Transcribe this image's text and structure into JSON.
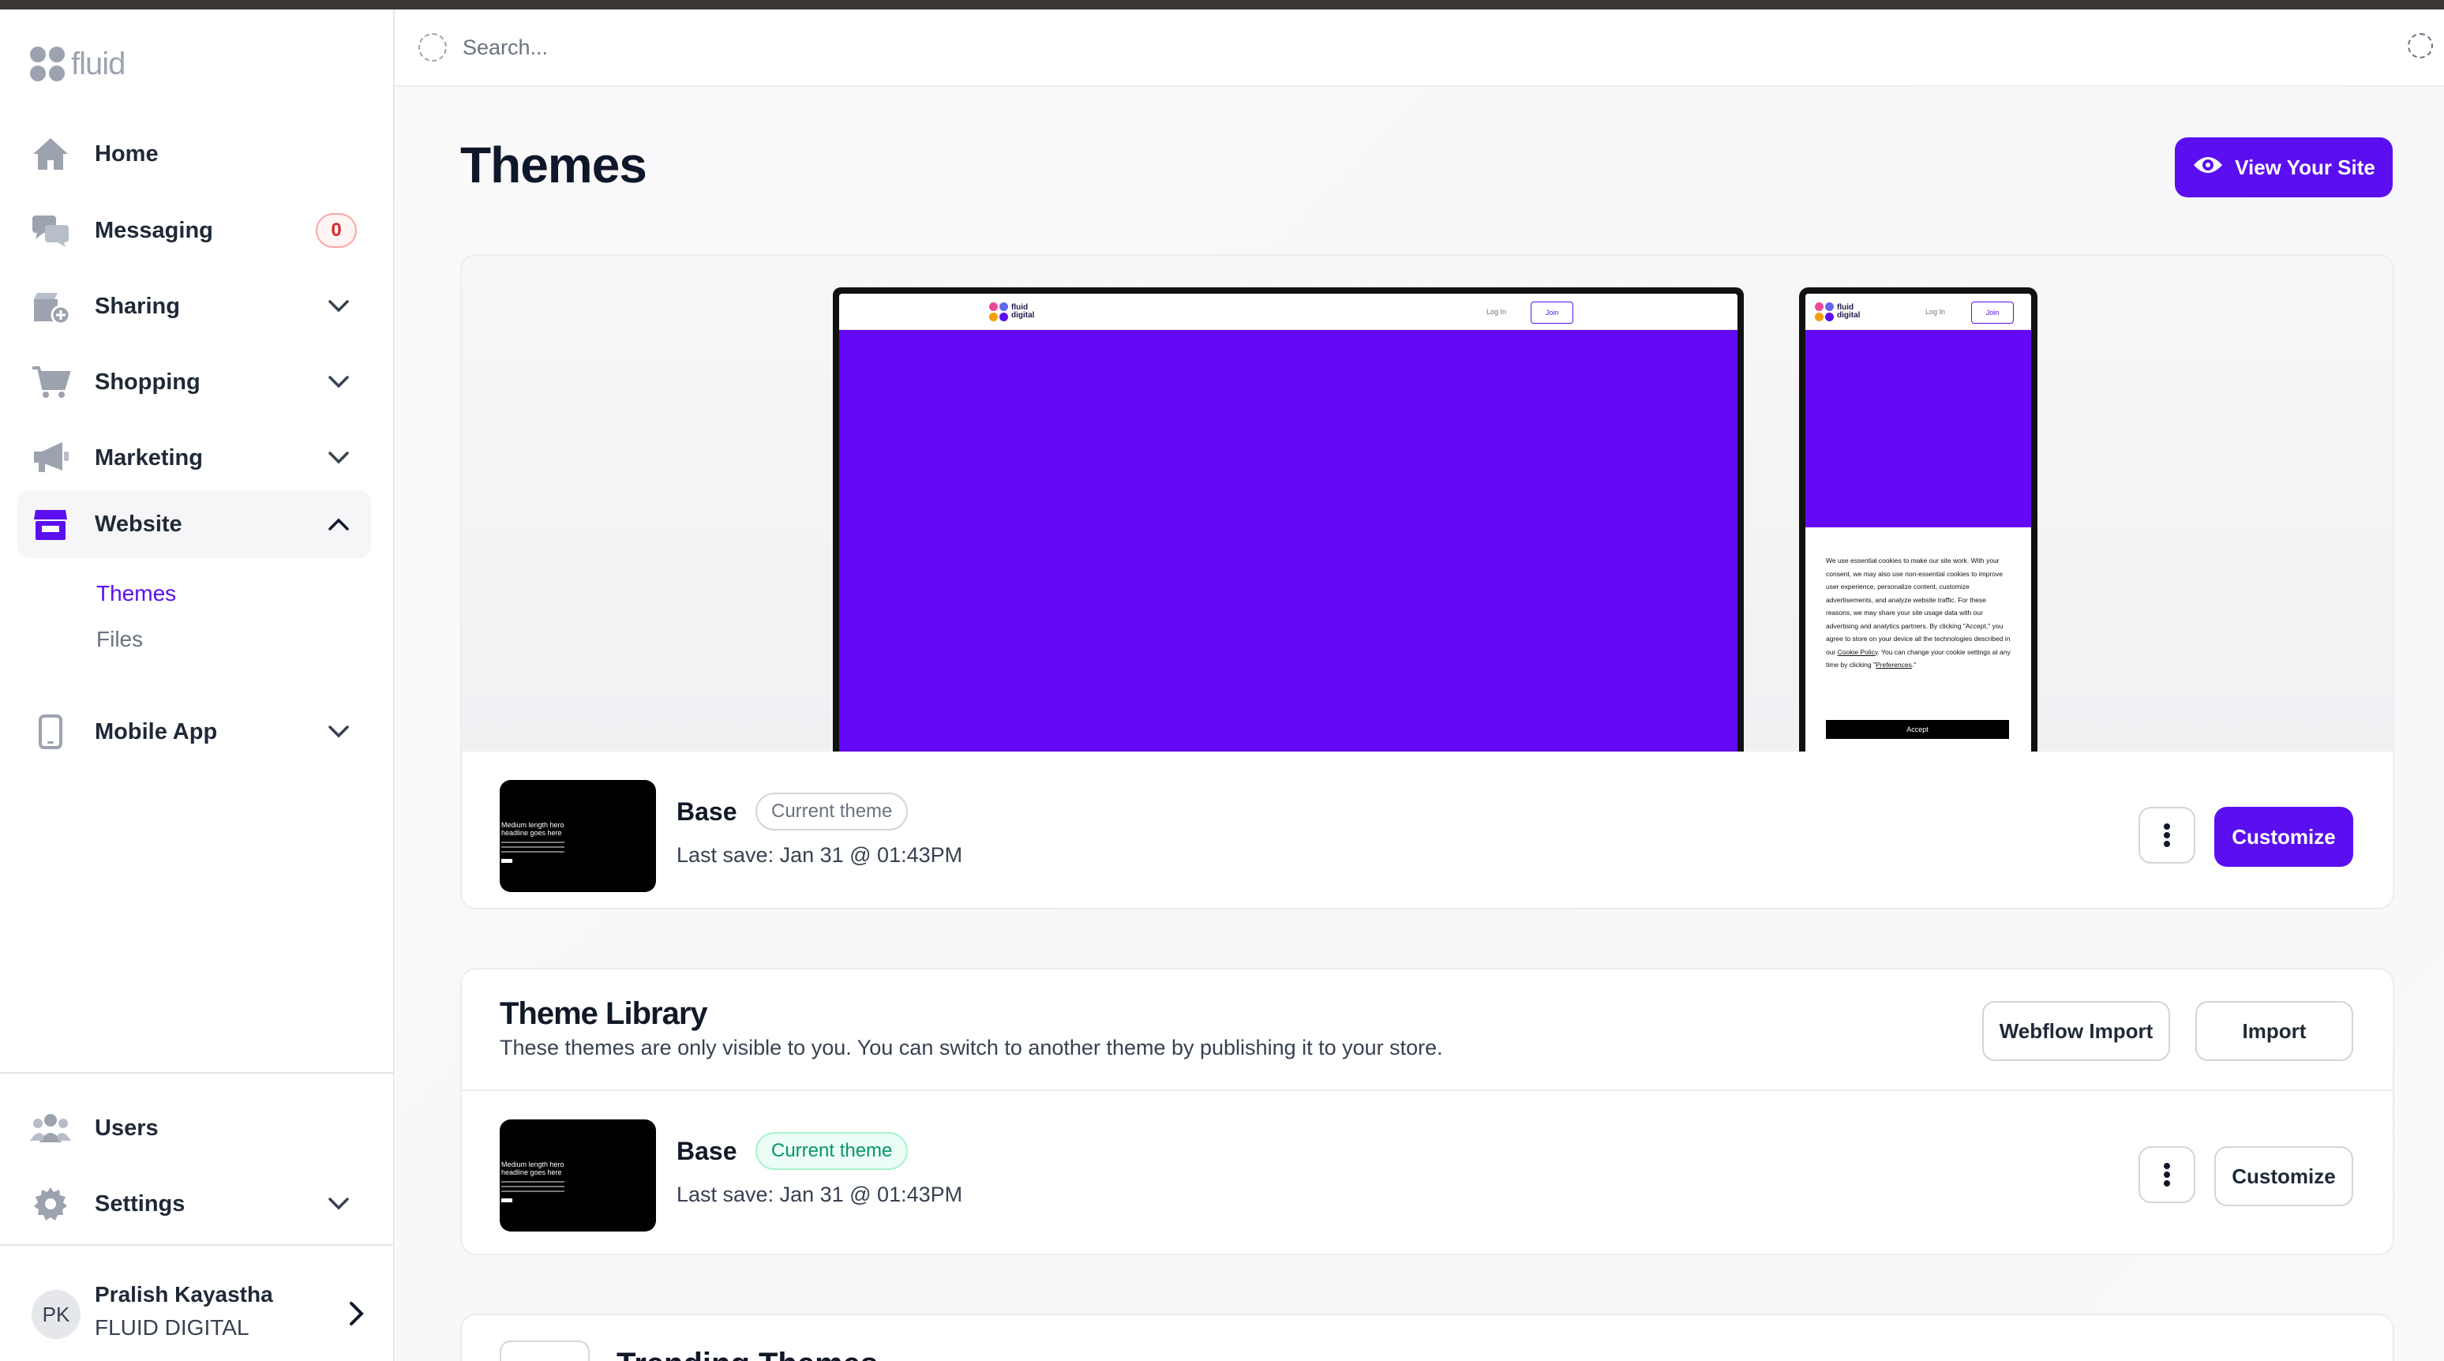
{
  "app": {
    "logo_text": "fluid"
  },
  "search": {
    "placeholder": "Search..."
  },
  "sidebar": {
    "items": [
      {
        "label": "Home"
      },
      {
        "label": "Messaging",
        "badge": "0"
      },
      {
        "label": "Sharing"
      },
      {
        "label": "Shopping"
      },
      {
        "label": "Marketing"
      },
      {
        "label": "Website",
        "sub_items": [
          "Themes",
          "Files"
        ]
      },
      {
        "label": "Mobile App"
      }
    ],
    "bottom_items": [
      {
        "label": "Users"
      },
      {
        "label": "Settings"
      }
    ],
    "user": {
      "initials": "PK",
      "name": "Pralish Kayastha",
      "org": "FLUID DIGITAL"
    }
  },
  "page": {
    "title": "Themes",
    "view_site_label": "View Your Site"
  },
  "preview": {
    "site_logo": "fluid digital",
    "login_label": "Log In",
    "join_label": "Join",
    "cookie_text_pre": "We use essential cookies to make our site work. With your consent, we may also use non-essential cookies to improve user experience, personalize content, customize advertisements, and analyze website traffic. For these reasons, we may share your site usage data with our advertising and analytics partners. By clicking \"Accept,\" you agree to store on your device all the technologies described in our ",
    "cookie_link": "Cookie Policy",
    "cookie_text_mid": ". You can change your cookie settings at any time by clicking \"",
    "cookie_link2": "Preferences",
    "cookie_text_end": ".\"",
    "accept_label": "Accept",
    "thumb_headline": "Medium length hero headline goes here"
  },
  "current_theme": {
    "name": "Base",
    "status": "Current theme",
    "last_save": "Last save: Jan 31 @ 01:43PM",
    "customize_label": "Customize"
  },
  "library": {
    "title": "Theme Library",
    "description": "These themes are only visible to you. You can switch to another theme by publishing it to your store.",
    "webflow_import_label": "Webflow Import",
    "import_label": "Import",
    "themes": [
      {
        "name": "Base",
        "status": "Current theme",
        "last_save": "Last save: Jan 31 @ 01:43PM",
        "customize_label": "Customize"
      }
    ]
  },
  "trending": {
    "title": "Trending Themes"
  },
  "colors": {
    "accent": "#5b0ff0",
    "hero": "#6309f5",
    "badge_red": "#dc2626",
    "status_green": "#059669"
  }
}
